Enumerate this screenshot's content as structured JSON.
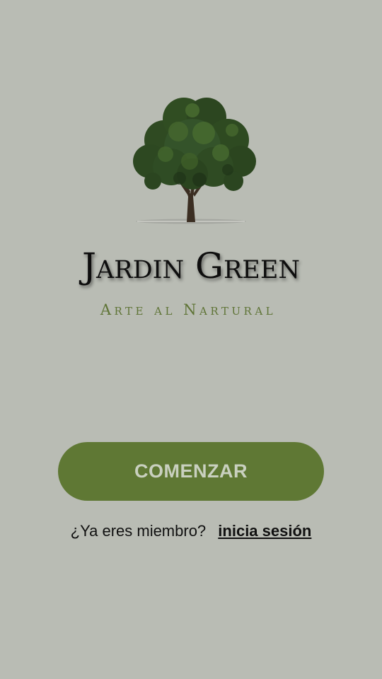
{
  "brand": {
    "title": "Jardin Green",
    "tagline": "Arte al Nartural",
    "logo_icon": "tree-icon",
    "title_color": "#0e0e0e",
    "tagline_color": "#5f7436"
  },
  "actions": {
    "start_label": "COMENZAR",
    "start_button_color": "#5f7834",
    "start_label_color": "#c9d0bf",
    "member_question": "¿Ya eres miembro?",
    "login_label": "inicia sesión"
  },
  "theme": {
    "background": "#b9bcb4"
  }
}
